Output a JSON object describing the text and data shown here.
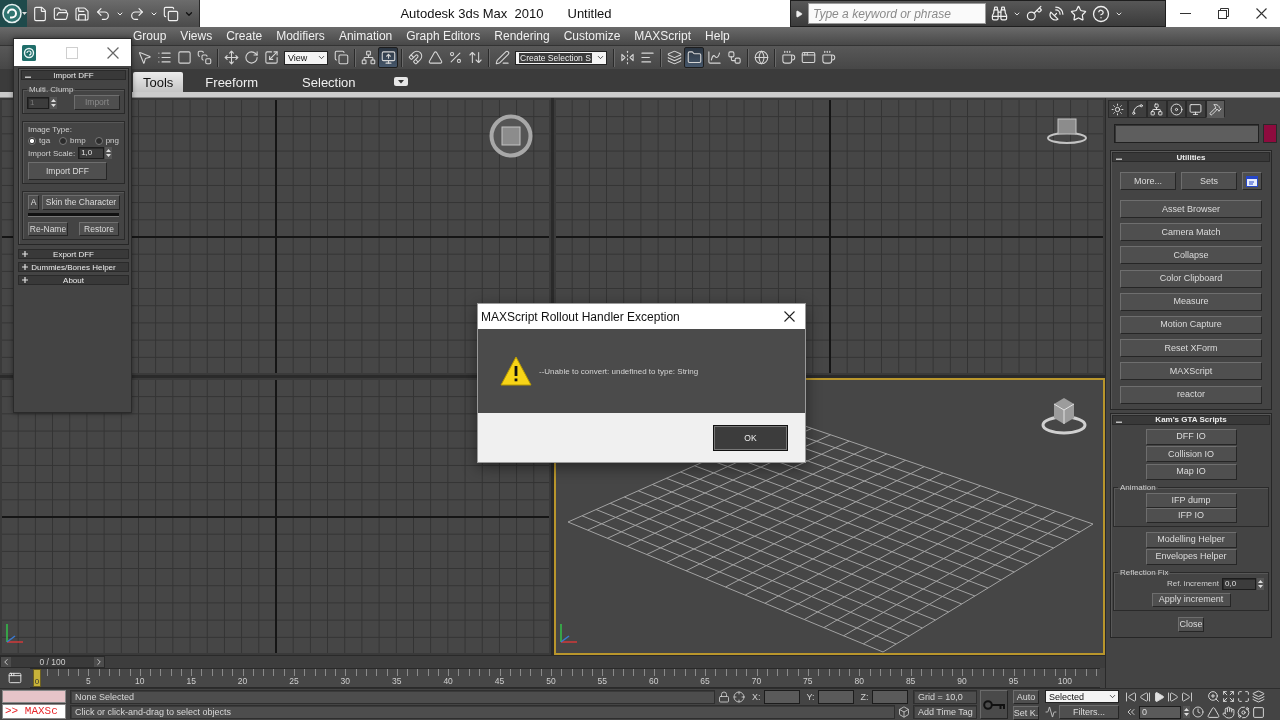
{
  "title_bar": {
    "app_title": "Autodesk 3ds Max  2010",
    "document": "Untitled",
    "search": {
      "placeholder": "Type a keyword or phrase"
    }
  },
  "menu": [
    "Group",
    "Views",
    "Create",
    "Modifiers",
    "Animation",
    "Graph Editors",
    "Rendering",
    "Customize",
    "MAXScript",
    "Help"
  ],
  "main_toolbar": {
    "view_dropdown": "View",
    "selection_set_dropdown": "Create Selection S",
    "buttons": [
      {
        "on": false
      },
      {
        "on": false
      },
      {
        "on": false
      },
      {
        "on": false
      },
      {
        "on": false
      },
      {
        "on": false
      },
      {
        "on": false
      },
      {
        "on": false
      },
      {
        "on": false
      },
      {
        "on": true
      },
      {
        "on": false
      },
      {
        "on": false
      },
      {
        "on": false
      },
      {
        "on": false
      },
      {
        "on": false
      },
      {
        "on": false
      },
      {
        "on": false
      },
      {
        "on": false
      },
      {
        "on": true
      },
      {
        "on": false
      },
      {
        "on": false
      },
      {
        "on": false
      },
      {
        "on": false
      },
      {
        "on": false
      },
      {
        "on": false
      }
    ]
  },
  "ribbon": {
    "tabs": [
      {
        "label": "Tools",
        "selected": true
      },
      {
        "label": "Freeform",
        "selected": false
      },
      {
        "label": "Selection",
        "selected": false
      }
    ]
  },
  "viewports": [
    {
      "kind": "grid",
      "active": false
    },
    {
      "kind": "grid",
      "active": false
    },
    {
      "kind": "grid",
      "active": false
    },
    {
      "kind": "perspective",
      "active": true
    }
  ],
  "time_slider": {
    "label": "0 / 100"
  },
  "track_bar": {
    "current": "0",
    "labels": [
      "5",
      "10",
      "15",
      "20",
      "25",
      "30",
      "35",
      "40",
      "45",
      "50",
      "55",
      "60",
      "65",
      "70",
      "75",
      "80",
      "85",
      "90",
      "95",
      "100"
    ]
  },
  "command_panel": {
    "tabs": [
      {
        "selected": false
      },
      {
        "selected": false
      },
      {
        "selected": false
      },
      {
        "selected": false
      },
      {
        "selected": false
      },
      {
        "selected": true
      }
    ],
    "utilities": {
      "title": "Utilities",
      "expanded": true,
      "top_buttons": [
        "More...",
        "Sets"
      ],
      "buttons": [
        "Asset Browser",
        "Camera Match",
        "Collapse",
        "Color Clipboard",
        "Measure",
        "Motion Capture",
        "Reset XForm",
        "MAXScript",
        "reactor"
      ]
    },
    "gta_scripts": {
      "title": "Kam's GTA Scripts",
      "expanded": true,
      "buttons": [
        "DFF IO",
        "Collision IO",
        "Map IO"
      ],
      "animation": {
        "label": "Animation",
        "buttons": [
          "IFP dump",
          "IFP IO"
        ]
      },
      "helpers": [
        "Modelling Helper",
        "Envelopes Helper"
      ],
      "reflection_fix": {
        "label": "Reflection Fix",
        "increment_label": "Ref. increment",
        "increment_value": "0,0",
        "apply_button": "Apply increment"
      },
      "close_button": "Close"
    }
  },
  "status_bar": {
    "listener_output": ">> MAXSc",
    "selection": "None Selected",
    "prompt": "Click or click-and-drag to select objects",
    "coordinates": [
      "X:",
      "Y:",
      "Z:"
    ],
    "grid": "Grid = 10,0",
    "time_tag": "Add Time Tag",
    "auto_key": "Auto",
    "set_key": "Set K.",
    "key_filter": "Selected",
    "filters": "Filters...",
    "frame": "0"
  },
  "floating_window": {
    "rollouts": [
      {
        "title": "Import DFF",
        "expanded": true,
        "body": {
          "multi_clump": {
            "label": "Multi. Clump",
            "value": "1",
            "button": "Import",
            "disabled": true
          },
          "image_type": {
            "label": "Image Type:",
            "options": [
              {
                "label": "tga",
                "selected": true
              },
              {
                "label": "bmp",
                "selected": false
              },
              {
                "label": "png",
                "selected": false
              }
            ]
          },
          "import_scale": {
            "label": "Import Scale:",
            "value": "1,0"
          },
          "import_button": "Import DFF",
          "skin": {
            "a_button": "A",
            "skin_button": "Skin the Character",
            "rename_button": "Re-Name",
            "restore_button": "Restore"
          }
        }
      },
      {
        "title": "Export DFF",
        "expanded": false
      },
      {
        "title": "Dummies/Bones Helper",
        "expanded": false
      },
      {
        "title": "About",
        "expanded": false
      }
    ]
  },
  "dialog": {
    "title": "MAXScript Rollout Handler Exception",
    "message": "--Unable to convert: undefined to type: String",
    "button": "OK"
  }
}
